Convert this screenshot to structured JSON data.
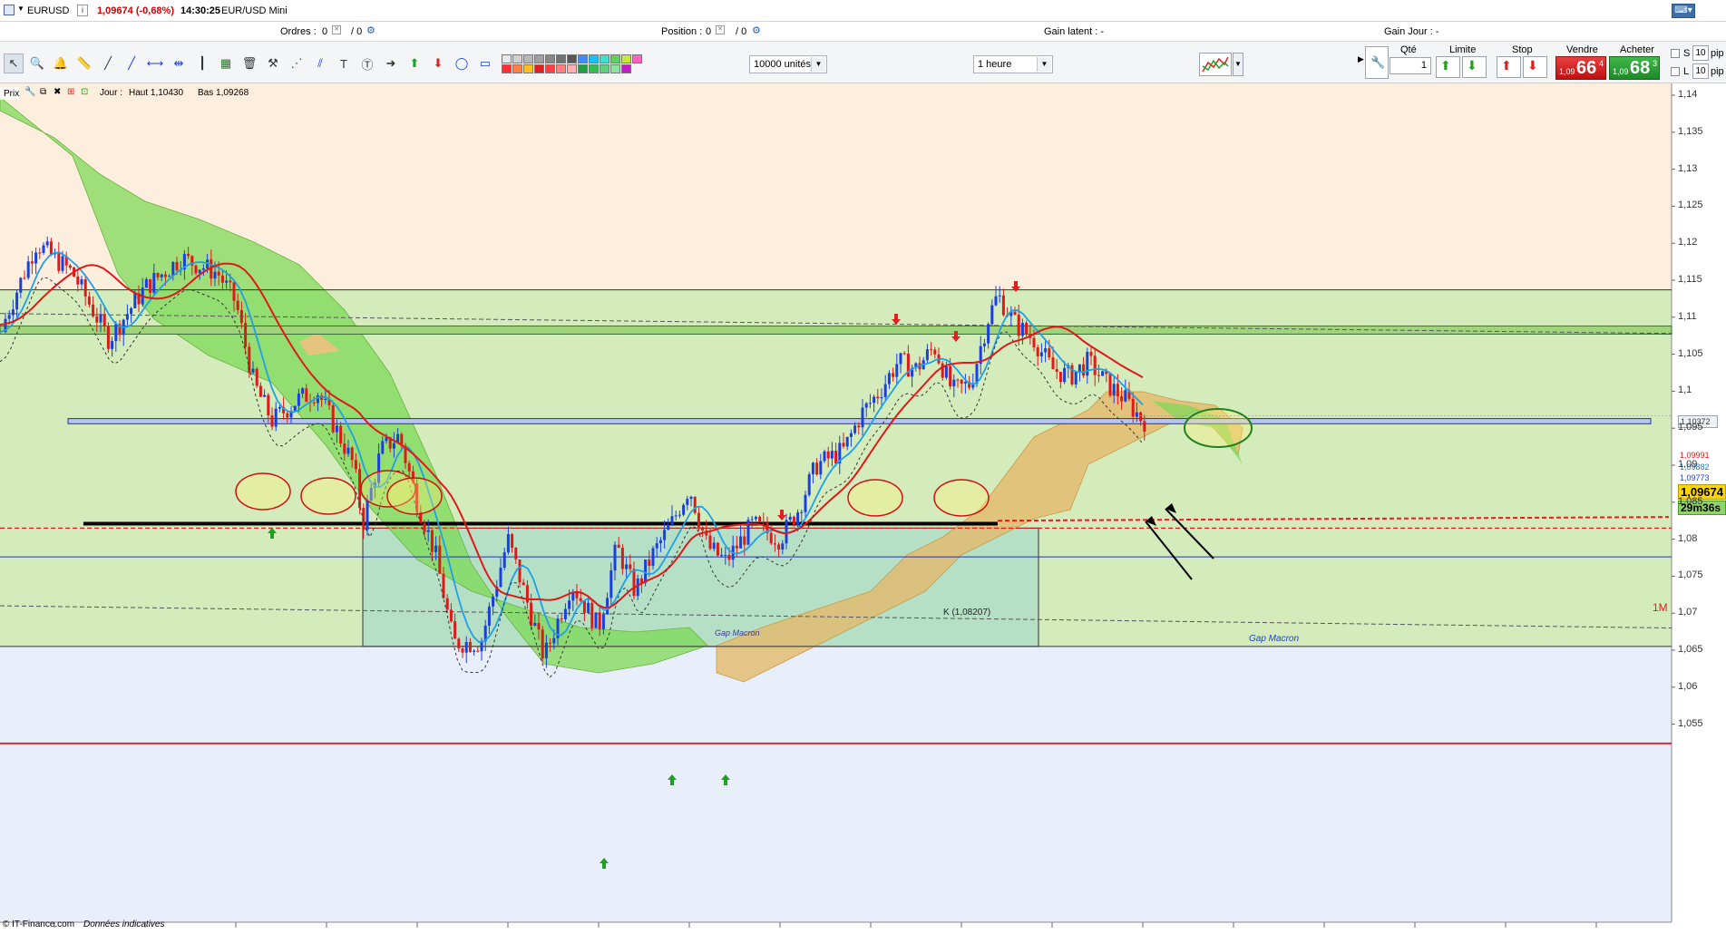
{
  "topbar": {
    "symbol": "EURUSD",
    "info_icon": "i",
    "price_change": "1,09674 (-0,68%)",
    "time": "14:30:25",
    "instrument_name": "EUR/USD Mini"
  },
  "stats": {
    "orders_label": "Ordres :",
    "orders_value": "0",
    "orders_value2": "/ 0",
    "position_label": "Position :",
    "position_value": "0",
    "position_value2": "/ 0",
    "gain_latent": "Gain latent : -",
    "gain_jour": "Gain Jour : -"
  },
  "toolbar": {
    "units_select": "10000 unités",
    "interval_select": "1 heure",
    "palette": [
      "#e8e8e8",
      "#d0d0d0",
      "#b8b8b8",
      "#a0a0a0",
      "#888888",
      "#707070",
      "#585858",
      "#3c8cff",
      "#18c0ff",
      "#40e0d0",
      "#60d060",
      "#c8e840",
      "#ff60c0",
      "#ff3030",
      "#ff8040",
      "#ffc020",
      "#e02020",
      "#ff4040",
      "#ff8080",
      "#ffb0b0",
      "#20a040",
      "#30c050",
      "#60d080",
      "#90e0a0",
      "#c020c0"
    ]
  },
  "order_panel": {
    "qty_label": "Qté",
    "qty_value": "1",
    "limit_label": "Limite",
    "stop_label": "Stop",
    "sell_label": "Vendre",
    "sell_price_small": "1,09",
    "sell_price_big": "66",
    "sell_price_sup": "4",
    "buy_label": "Acheter",
    "buy_price_small": "1,09",
    "buy_price_big": "68",
    "buy_price_sup": "3",
    "s_label": "S",
    "l_label": "L",
    "pip_value1": "10",
    "pip_value2": "10",
    "pip_unit": "pip"
  },
  "legend": {
    "prix": "Prix",
    "jour": "Jour :",
    "haut": "Haut 1,10430",
    "bas": "Bas 1,09268"
  },
  "price_axis": {
    "labels": [
      "1,14",
      "1,135",
      "1,13",
      "1,125",
      "1,12",
      "1,115",
      "1,11",
      "1,105",
      "1,1",
      "1,095",
      "1,09",
      "1,085",
      "1,08",
      "1,075",
      "1,07",
      "1,065",
      "1,06",
      "1,055"
    ],
    "values": [
      1.14,
      1.135,
      1.13,
      1.125,
      1.12,
      1.115,
      1.11,
      1.105,
      1.1,
      1.095,
      1.09,
      1.085,
      1.08,
      1.075,
      1.07,
      1.065,
      1.06,
      1.055
    ]
  },
  "price_tags": {
    "cloud": "1,10372",
    "red": "1,09991",
    "blue1": "1,09882",
    "blue2": "1,09773",
    "current": "1,09674",
    "countdown": "29m36s"
  },
  "annotations": {
    "k_level": "K (1,08207)",
    "gap_label": "Gap Macron",
    "month_label": "1M",
    "gap_small": "Gap Macron"
  },
  "footer": {
    "source": "© IT-Finance.com",
    "note": "Données indicatives"
  },
  "colors": {
    "bull": "#1a3fe0",
    "bear": "#e01818",
    "kijun": "#e01818",
    "tenkan": "#1ea0e8",
    "cloud_bull": "#7ed957",
    "cloud_bear": "#e3b96a",
    "zone_peach": "#fdeedd",
    "zone_green": "#d4ecbc",
    "zone_blue": "#e9eefb",
    "gap_box": "#a8dccb"
  }
}
